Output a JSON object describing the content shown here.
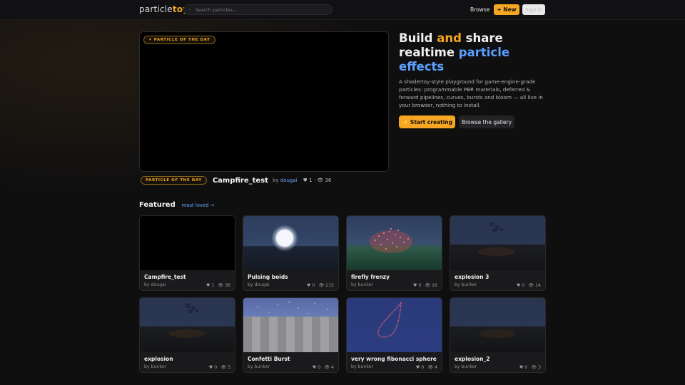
{
  "header": {
    "logo_part1": "particle",
    "logo_part2": "toy",
    "search_placeholder": "Search particles...",
    "browse_label": "Browse",
    "new_label": "+ New",
    "signin_label": "Sign in"
  },
  "hero": {
    "canvas_badge": "✦ PARTICLE OF THE DAY",
    "badge": "PARTICLE OF THE DAY",
    "title": "Campfire_test",
    "by_prefix": "by",
    "author": "dougai",
    "likes": "♥ 1",
    "sep": "·",
    "views": "👁 36",
    "headline": {
      "w1": "Build",
      "w2": "and",
      "w3": "share",
      "w4": "realtime",
      "w5": "particle effects"
    },
    "description": "A shadertoy-style playground for game-engine-grade particles: programmable PBR materials, deferred & forward pipelines, curves, bursts and bloom — all live in your browser, nothing to install.",
    "start_label": "✨ Start creating",
    "gallery_label": "Browse the gallery"
  },
  "featured": {
    "title": "Featured",
    "link": "most loved →",
    "cards": [
      {
        "title": "Campfire_test",
        "author": "by dougai",
        "likes": "♥ 1",
        "views": "👁 36"
      },
      {
        "title": "Pulsing boids",
        "author": "by dougai",
        "likes": "♥ 0",
        "views": "👁 215"
      },
      {
        "title": "firefly frenzy",
        "author": "by bunker",
        "likes": "♥ 0",
        "views": "👁 16"
      },
      {
        "title": "explosion 3",
        "author": "by bunker",
        "likes": "♥ 0",
        "views": "👁 14"
      },
      {
        "title": "explosion",
        "author": "by bunker",
        "likes": "♥ 0",
        "views": "👁 5"
      },
      {
        "title": "Confetti Burst",
        "author": "by bunker",
        "likes": "♥ 0",
        "views": "👁 4"
      },
      {
        "title": "very wrong fibonacci sphere",
        "author": "by bunker",
        "likes": "♥ 0",
        "views": "👁 4"
      },
      {
        "title": "explosion_2",
        "author": "by bunker",
        "likes": "♥ 0",
        "views": "👁 3"
      }
    ]
  },
  "colors": {
    "accent": "#f5a623",
    "link": "#6aa6ff",
    "background": "#0f0f10"
  }
}
